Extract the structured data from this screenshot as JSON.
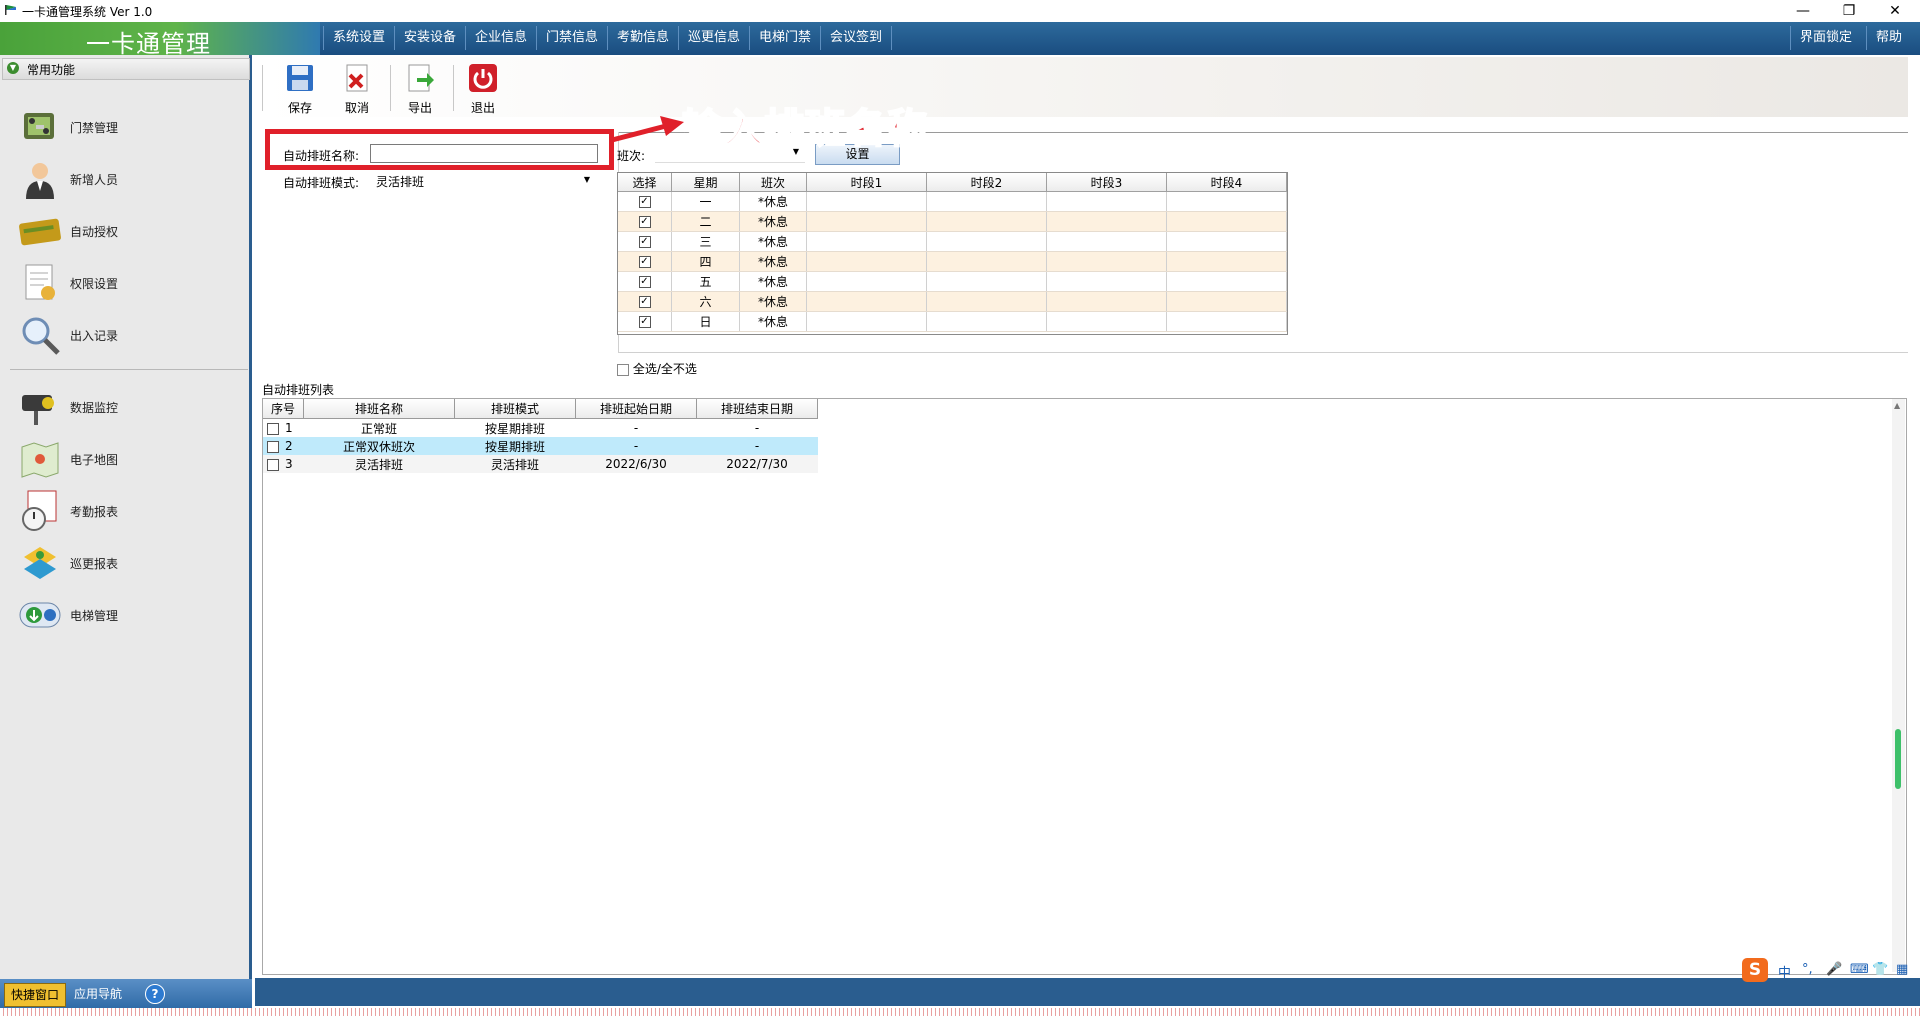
{
  "window": {
    "title": "一卡通管理系统  Ver 1.0",
    "controls": {
      "minimize": "—",
      "restore": "❐",
      "close": "✕"
    }
  },
  "header": {
    "logo_text": "一卡通管理",
    "menu": [
      "系统设置",
      "安装设备",
      "企业信息",
      "门禁信息",
      "考勤信息",
      "巡更信息",
      "电梯门禁",
      "会议签到"
    ],
    "right_menu": [
      "界面锁定",
      "帮助"
    ]
  },
  "sidebar": {
    "section_title": "常用功能",
    "items_top": [
      {
        "label": "门禁管理",
        "icon": "door-access-icon"
      },
      {
        "label": "新增人员",
        "icon": "person-icon"
      },
      {
        "label": "自动授权",
        "icon": "card-icon"
      },
      {
        "label": "权限设置",
        "icon": "permission-doc-icon"
      },
      {
        "label": "出入记录",
        "icon": "magnifier-icon"
      }
    ],
    "items_bottom": [
      {
        "label": "数据监控",
        "icon": "camera-icon"
      },
      {
        "label": "电子地图",
        "icon": "map-icon"
      },
      {
        "label": "考勤报表",
        "icon": "clock-report-icon"
      },
      {
        "label": "巡更报表",
        "icon": "patrol-icon"
      },
      {
        "label": "电梯管理",
        "icon": "elevator-icon"
      }
    ],
    "tabs": {
      "quick": "快捷窗口",
      "appnav": "应用导航",
      "help": "?"
    }
  },
  "toolbar": {
    "save": "保存",
    "cancel": "取消",
    "export": "导出",
    "exit": "退出"
  },
  "form": {
    "name_label": "自动排班名称:",
    "name_value": "",
    "mode_label": "自动排班模式:",
    "mode_value": "灵活排班",
    "shift_label": "班次:",
    "shift_value": "",
    "set_button": "设置",
    "select_all": "全选/全不选"
  },
  "annotation": "输入排班名称",
  "schedule_grid": {
    "headers": [
      "选择",
      "星期",
      "班次",
      "时段1",
      "时段2",
      "时段3",
      "时段4"
    ],
    "rows": [
      {
        "checked": true,
        "day": "一",
        "shift": "*休息"
      },
      {
        "checked": true,
        "day": "二",
        "shift": "*休息"
      },
      {
        "checked": true,
        "day": "三",
        "shift": "*休息"
      },
      {
        "checked": true,
        "day": "四",
        "shift": "*休息"
      },
      {
        "checked": true,
        "day": "五",
        "shift": "*休息"
      },
      {
        "checked": true,
        "day": "六",
        "shift": "*休息"
      },
      {
        "checked": true,
        "day": "日",
        "shift": "*休息"
      }
    ]
  },
  "schedule_list": {
    "title": "自动排班列表",
    "headers": [
      "序号",
      "排班名称",
      "排班模式",
      "排班起始日期",
      "排班结束日期"
    ],
    "rows": [
      {
        "no": "1",
        "name": "正常班",
        "mode": "按星期排班",
        "start": "-",
        "end": "-"
      },
      {
        "no": "2",
        "name": "正常双休班次",
        "mode": "按星期排班",
        "start": "-",
        "end": "-"
      },
      {
        "no": "3",
        "name": "灵活排班",
        "mode": "灵活排班",
        "start": "2022/6/30",
        "end": "2022/7/30"
      }
    ]
  },
  "ime": {
    "logo": "S",
    "lang": "中",
    "punct": "°,",
    "mic": "🎤",
    "keyboard": "⌨",
    "skin": "👕",
    "grid": "▦"
  },
  "colors": {
    "accent_red": "#e0202a",
    "header_blue": "#1a4d80",
    "selected_row": "#bfeafb"
  }
}
